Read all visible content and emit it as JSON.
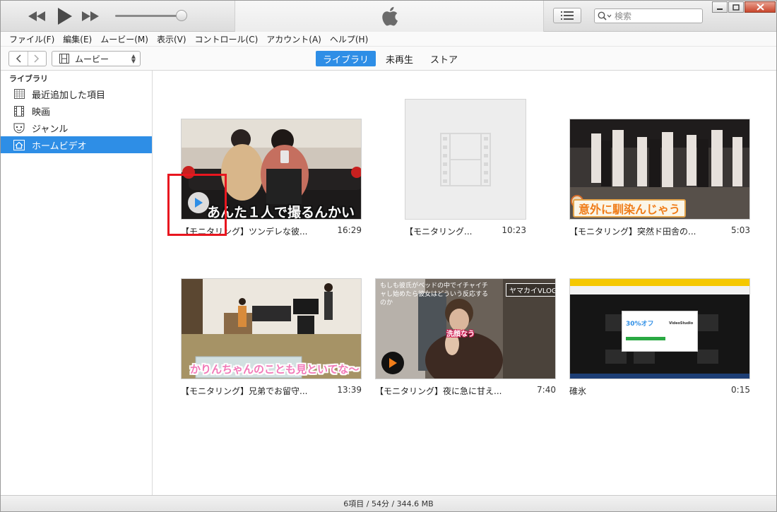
{
  "window": {
    "search_placeholder": "検索",
    "brand_icon": "apple-logo-icon"
  },
  "menu": [
    "ファイル(F)",
    "編集(E)",
    "ムービー(M)",
    "表示(V)",
    "コントロール(C)",
    "アカウント(A)",
    "ヘルプ(H)"
  ],
  "navbar": {
    "media_type": "ムービー",
    "tabs": [
      {
        "label": "ライブラリ",
        "active": true
      },
      {
        "label": "未再生",
        "active": false
      },
      {
        "label": "ストア",
        "active": false
      }
    ]
  },
  "sidebar": {
    "heading": "ライブラリ",
    "items": [
      {
        "label": "最近追加した項目",
        "icon": "grid-icon",
        "selected": false
      },
      {
        "label": "映画",
        "icon": "film-icon",
        "selected": false
      },
      {
        "label": "ジャンル",
        "icon": "masks-icon",
        "selected": false
      },
      {
        "label": "ホームビデオ",
        "icon": "home-icon",
        "selected": true
      }
    ]
  },
  "videos": [
    {
      "title": "【モニタリング】ツンデレな彼...",
      "duration": "16:29",
      "caption": "あんた１人で撮るんかい"
    },
    {
      "title": "【モニタリング...",
      "duration": "10:23",
      "caption": ""
    },
    {
      "title": "【モニタリング】突然ド田舎の...",
      "duration": "5:03",
      "caption": "意外に馴染んじゃう"
    },
    {
      "title": "【モニタリング】兄弟でお留守...",
      "duration": "13:39",
      "caption": "かりんちゃんのことも見といてな〜"
    },
    {
      "title": "【モニタリング】夜に急に甘え...",
      "duration": "7:40",
      "caption": "洗顔なう",
      "overlay_top": "もしも彼氏がベッドの中でイチャイチャし始めたら彼女はどういう反応するのか",
      "badge": "ヤマカイVLOG"
    },
    {
      "title": "碓氷",
      "duration": "0:15",
      "caption": "",
      "popup_heading": "30%オフ",
      "popup_brand": "VideoStudio"
    }
  ],
  "status": {
    "summary": "6項目 / 54分 / 344.6 MB"
  },
  "colors": {
    "accent": "#2e8ee6",
    "highlight": "#e8161f"
  }
}
